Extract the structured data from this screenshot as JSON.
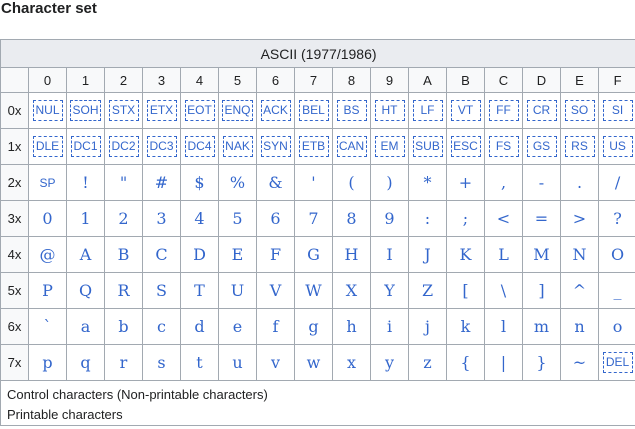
{
  "heading": "Character set",
  "caption": "ASCII (1977/1986)",
  "column_headers": [
    "0",
    "1",
    "2",
    "3",
    "4",
    "5",
    "6",
    "7",
    "8",
    "9",
    "A",
    "B",
    "C",
    "D",
    "E",
    "F"
  ],
  "rows": [
    {
      "label": "0x",
      "kind": [
        "c",
        "c",
        "c",
        "c",
        "c",
        "c",
        "c",
        "c",
        "c",
        "c",
        "c",
        "c",
        "c",
        "c",
        "c",
        "c"
      ],
      "cells": [
        "NUL",
        "SOH",
        "STX",
        "ETX",
        "EOT",
        "ENQ",
        "ACK",
        "BEL",
        "BS",
        "HT",
        "LF",
        "VT",
        "FF",
        "CR",
        "SO",
        "SI"
      ]
    },
    {
      "label": "1x",
      "kind": [
        "c",
        "c",
        "c",
        "c",
        "c",
        "c",
        "c",
        "c",
        "c",
        "c",
        "c",
        "c",
        "c",
        "c",
        "c",
        "c"
      ],
      "cells": [
        "DLE",
        "DC1",
        "DC2",
        "DC3",
        "DC4",
        "NAK",
        "SYN",
        "ETB",
        "CAN",
        "EM",
        "SUB",
        "ESC",
        "FS",
        "GS",
        "RS",
        "US"
      ]
    },
    {
      "label": "2x",
      "kind": [
        "s",
        "p",
        "p",
        "p",
        "p",
        "p",
        "p",
        "p",
        "p",
        "p",
        "p",
        "p",
        "p",
        "p",
        "p",
        "p"
      ],
      "cells": [
        "SP",
        "!",
        "\"",
        "#",
        "$",
        "%",
        "&",
        "'",
        "(",
        ")",
        "*",
        "+",
        ",",
        "-",
        ".",
        "/"
      ]
    },
    {
      "label": "3x",
      "kind": [
        "p",
        "p",
        "p",
        "p",
        "p",
        "p",
        "p",
        "p",
        "p",
        "p",
        "p",
        "p",
        "p",
        "p",
        "p",
        "p"
      ],
      "cells": [
        "0",
        "1",
        "2",
        "3",
        "4",
        "5",
        "6",
        "7",
        "8",
        "9",
        ":",
        ";",
        "<",
        "=",
        ">",
        "?"
      ]
    },
    {
      "label": "4x",
      "kind": [
        "p",
        "p",
        "p",
        "p",
        "p",
        "p",
        "p",
        "p",
        "p",
        "p",
        "p",
        "p",
        "p",
        "p",
        "p",
        "p"
      ],
      "cells": [
        "@",
        "A",
        "B",
        "C",
        "D",
        "E",
        "F",
        "G",
        "H",
        "I",
        "J",
        "K",
        "L",
        "M",
        "N",
        "O"
      ]
    },
    {
      "label": "5x",
      "kind": [
        "p",
        "p",
        "p",
        "p",
        "p",
        "p",
        "p",
        "p",
        "p",
        "p",
        "p",
        "p",
        "p",
        "p",
        "p",
        "p"
      ],
      "cells": [
        "P",
        "Q",
        "R",
        "S",
        "T",
        "U",
        "V",
        "W",
        "X",
        "Y",
        "Z",
        "[",
        "\\",
        "]",
        "^",
        "_"
      ]
    },
    {
      "label": "6x",
      "kind": [
        "p",
        "p",
        "p",
        "p",
        "p",
        "p",
        "p",
        "p",
        "p",
        "p",
        "p",
        "p",
        "p",
        "p",
        "p",
        "p"
      ],
      "cells": [
        "`",
        "a",
        "b",
        "c",
        "d",
        "e",
        "f",
        "g",
        "h",
        "i",
        "j",
        "k",
        "l",
        "m",
        "n",
        "o"
      ]
    },
    {
      "label": "7x",
      "kind": [
        "p",
        "p",
        "p",
        "p",
        "p",
        "p",
        "p",
        "p",
        "p",
        "p",
        "p",
        "p",
        "p",
        "p",
        "p",
        "c"
      ],
      "cells": [
        "p",
        "q",
        "r",
        "s",
        "t",
        "u",
        "v",
        "w",
        "x",
        "y",
        "z",
        "{",
        "|",
        "}",
        "~",
        "DEL"
      ]
    }
  ],
  "legend": {
    "control": "Control characters (Non-printable characters)",
    "printable": "Printable characters"
  },
  "colors": {
    "link": "#3366cc",
    "border": "#a2a9b1",
    "header_bg": "#eaecf0"
  }
}
